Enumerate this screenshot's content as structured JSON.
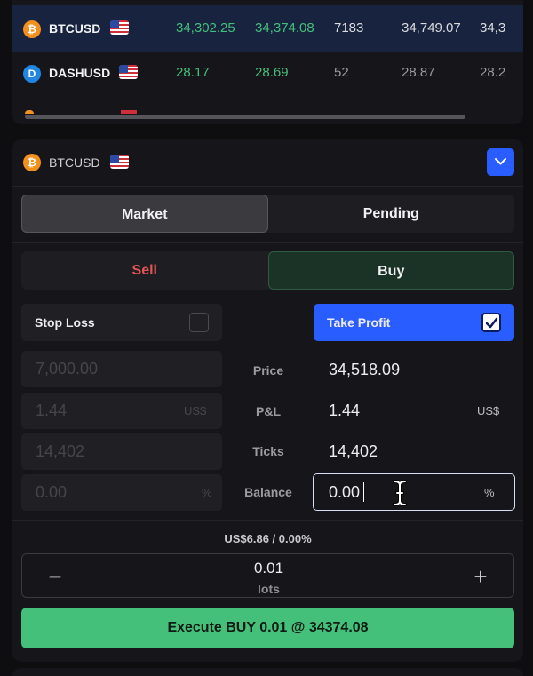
{
  "quotes": {
    "rows": [
      {
        "symbol": "BTCUSD",
        "coin_icon": "bitcoin-icon",
        "coin_glyph": "₿",
        "bid": "34,302.25",
        "ask": "34,374.08",
        "spread": "7183",
        "high": "34,749.07",
        "low": "34,3"
      },
      {
        "symbol": "DASHUSD",
        "coin_icon": "dash-icon",
        "coin_glyph": "D",
        "bid": "28.17",
        "ask": "28.69",
        "spread": "52",
        "high": "28.87",
        "low": "28.2"
      }
    ]
  },
  "order": {
    "symbol": "BTCUSD",
    "coin_glyph": "₿",
    "order_type_tabs": {
      "market": "Market",
      "pending": "Pending",
      "active": "Market"
    },
    "side_tabs": {
      "sell": "Sell",
      "buy": "Buy",
      "active": "Buy"
    },
    "stop_loss": {
      "label": "Stop Loss",
      "checked": false,
      "price": "7,000.00",
      "pnl": "1.44",
      "pnl_unit": "US$",
      "ticks": "14,402",
      "balance": "0.00",
      "balance_unit": "%"
    },
    "row_labels": {
      "price": "Price",
      "pnl": "P&L",
      "ticks": "Ticks",
      "balance": "Balance"
    },
    "take_profit": {
      "label": "Take Profit",
      "checked": true,
      "price": "34,518.09",
      "pnl": "1.44",
      "pnl_unit": "US$",
      "ticks": "14,402",
      "balance": "0.00",
      "balance_unit": "%"
    },
    "summary": "US$6.86 / 0.00%",
    "lots": {
      "value": "0.01",
      "unit": "lots",
      "minus": "−",
      "plus": "+"
    },
    "execute_label": "Execute BUY 0.01 @ 34374.08"
  },
  "colors": {
    "accent_blue": "#2a5dff",
    "buy_green": "#45c07a",
    "sell_red": "#e25555"
  }
}
